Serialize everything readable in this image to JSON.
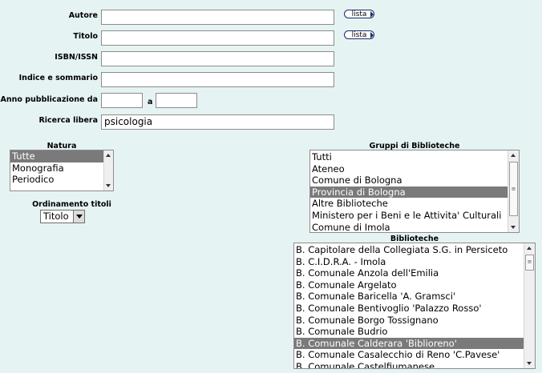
{
  "form": {
    "autore_label": "Autore",
    "titolo_label": "Titolo",
    "isbn_label": "ISBN/ISSN",
    "indice_label": "Indice e sommario",
    "anno_label": "Anno pubblicazione da",
    "anno_a_label": "a",
    "ricerca_label": "Ricerca libera",
    "ricerca_value": "psicologia",
    "lista_label": "lista"
  },
  "natura": {
    "header": "Natura",
    "options": [
      "Tutte",
      "Monografia",
      "Periodico"
    ],
    "selected_index": 0
  },
  "ordinamento": {
    "header": "Ordinamento titoli",
    "value": "Titolo"
  },
  "gruppi": {
    "header": "Gruppi di Biblioteche",
    "options": [
      "Tutti",
      "Ateneo",
      "Comune di Bologna",
      "Provincia di Bologna",
      "Altre Biblioteche",
      "Ministero per i Beni e le Attivita' Culturali",
      "Comune di Imola"
    ],
    "selected_index": 3
  },
  "biblioteche": {
    "header": "Biblioteche",
    "options": [
      "B. Capitolare della Collegiata S.G. in Persiceto",
      "B. C.I.D.R.A. - Imola",
      "B. Comunale Anzola dell'Emilia",
      "B. Comunale Argelato",
      "B. Comunale Baricella 'A. Gramsci'",
      "B. Comunale Bentivoglio 'Palazzo Rosso'",
      "B. Comunale Borgo Tossignano",
      "B. Comunale Budrio",
      "B. Comunale Calderara 'Biblioreno'",
      "B. Comunale Casalecchio di Reno 'C.Pavese'",
      "B. Comunale Castelfiumanese"
    ],
    "selected_index": 8
  },
  "icons": {
    "lista_arrow": "play-arrow-icon",
    "scroll_up": "arrow-up-icon",
    "scroll_down": "arrow-down-icon",
    "dropdown": "chevron-down-icon"
  },
  "colors": {
    "background": "#e6f3f3",
    "selection": "#7a7a7a",
    "button_border": "#1a2a6e"
  }
}
